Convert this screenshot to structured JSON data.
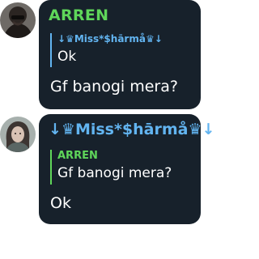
{
  "messages": [
    {
      "sender": "ARREN",
      "sender_color": "#5fd65a",
      "reply": {
        "sender": "↓♛Miss*$hārmå♛↓",
        "sender_color": "#62b4f0",
        "text": "Ok"
      },
      "text": "Gf banogi mera?"
    },
    {
      "sender": "↓♛Miss*$hārmå♛↓",
      "sender_color": "#62b4f0",
      "reply": {
        "sender": "ARREN",
        "sender_color": "#5fd65a",
        "text": "Gf banogi mera?"
      },
      "text": "Ok"
    }
  ],
  "theme": {
    "bubble_background": "#17212b",
    "text_color": "#ffffff"
  },
  "icons": {
    "avatar_1": "profile-photo-dark-person",
    "avatar_2": "profile-photo-girl"
  }
}
